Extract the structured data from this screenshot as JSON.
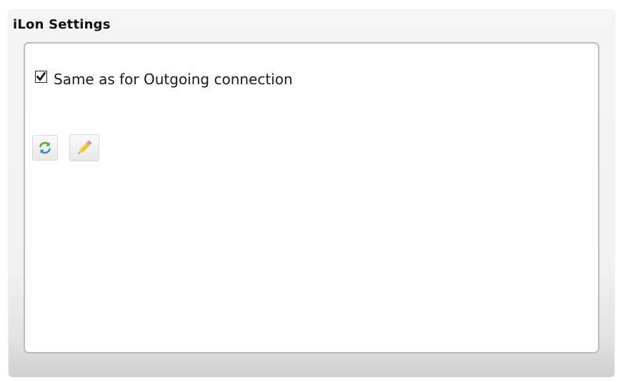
{
  "panel": {
    "title": "iLon Settings"
  },
  "settings": {
    "same_as_outgoing": {
      "label": "Same as for Outgoing connection",
      "checked": true
    }
  },
  "toolbar": {
    "buttons": [
      {
        "icon": "refresh-icon"
      },
      {
        "icon": "pencil-icon"
      }
    ]
  },
  "colors": {
    "panel_bg": "#f1f1f1",
    "content_border": "#bdbdbd",
    "refresh_green": "#4caf3a",
    "pencil_yellow": "#f2c21b"
  }
}
